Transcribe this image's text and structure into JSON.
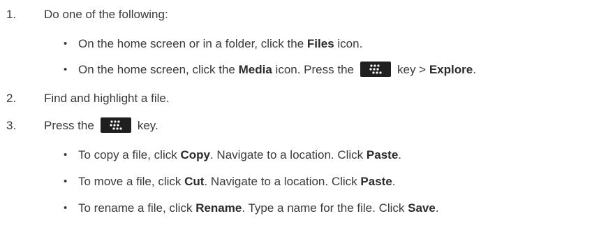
{
  "steps": [
    {
      "number": "1.",
      "text": "Do one of the following:"
    },
    {
      "number": "2.",
      "text": "Find and highlight a file."
    },
    {
      "number": "3.",
      "pre": "Press the",
      "post": "key."
    }
  ],
  "step1_bullets": [
    {
      "pre": "On the home screen or in a folder, click the",
      "bold": "Files",
      "post": "icon."
    },
    {
      "pre": "On the home screen, click the",
      "bold": "Media",
      "mid": "icon. Press the",
      "post": "key >",
      "bold2": "Explore",
      "end": "."
    }
  ],
  "step3_bullets": [
    {
      "a": "To copy a file, click",
      "b": "Copy",
      "c": ". Navigate to a location. Click",
      "d": "Paste",
      "e": "."
    },
    {
      "a": "To move a file, click",
      "b": "Cut",
      "c": ". Navigate to a location. Click",
      "d": "Paste",
      "e": "."
    },
    {
      "a": "To rename a file, click",
      "b": "Rename",
      "c": ". Type a name for the file. Click",
      "d": "Save",
      "e": "."
    }
  ],
  "bullet_char": "•",
  "icons": {
    "menu_key": "blackberry-menu-key-icon"
  },
  "colors": {
    "text": "#3a3a3a",
    "key_bg": "#1f1f1f"
  }
}
